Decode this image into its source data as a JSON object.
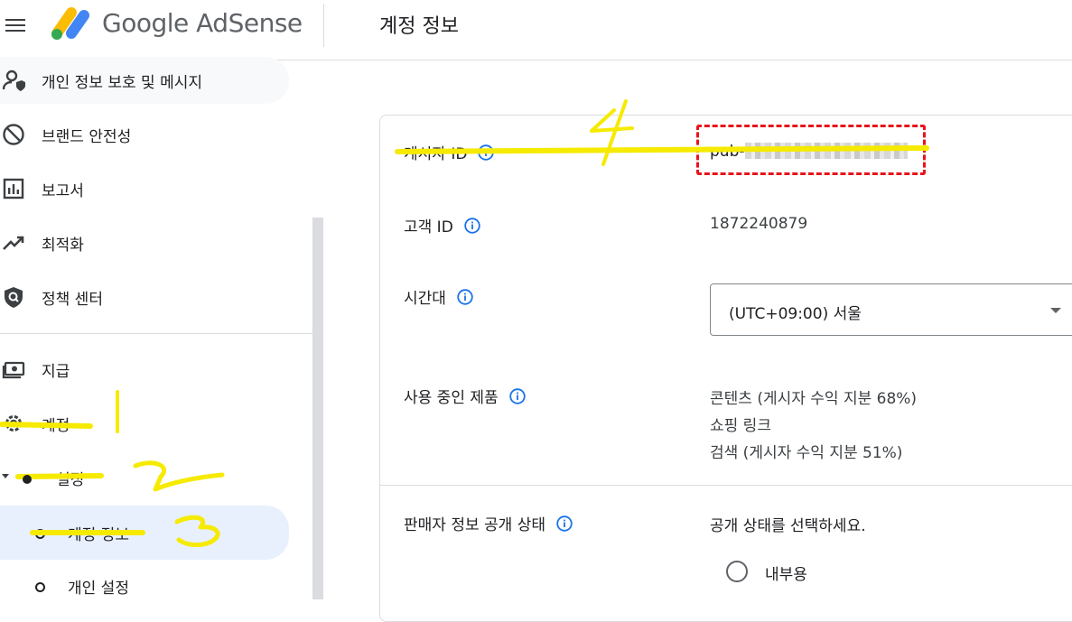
{
  "header": {
    "brand": "Google AdSense",
    "page_title": "계정 정보"
  },
  "sidebar": {
    "items": [
      {
        "label": "개인 정보 보호 및 메시지",
        "icon": "privacy-icon"
      },
      {
        "label": "브랜드 안전성",
        "icon": "block-icon"
      },
      {
        "label": "보고서",
        "icon": "report-icon"
      },
      {
        "label": "최적화",
        "icon": "trending-up-icon"
      },
      {
        "label": "정책 센터",
        "icon": "policy-icon"
      },
      {
        "label": "지급",
        "icon": "payments-icon"
      },
      {
        "label": "계정",
        "icon": "gear-icon"
      },
      {
        "label": "설정",
        "icon": "chevron-down-icon"
      },
      {
        "label": "계정 정보",
        "icon": "bullet-icon"
      },
      {
        "label": "개인 설정",
        "icon": "bullet-icon"
      }
    ]
  },
  "account": {
    "publisher_id_label": "게시자 ID",
    "publisher_id_prefix": "pub-",
    "customer_id_label": "고객 ID",
    "customer_id_value": "1872240879",
    "timezone_label": "시간대",
    "timezone_value": "(UTC+09:00) 서울",
    "products_label": "사용 중인 제품",
    "products": [
      "콘텐츠 (게시자 수익 지분 68%)",
      "쇼핑 링크",
      "검색 (게시자 수익 지분 51%)"
    ],
    "seller_label": "판매자 정보 공개 상태",
    "seller_prompt": "공개 상태를 선택하세요.",
    "seller_option": "내부용"
  },
  "colors": {
    "accent": "#1a73e8",
    "active_bg": "#e8f0fe",
    "highlight": "#ffee00",
    "redbox": "#e8141b"
  }
}
